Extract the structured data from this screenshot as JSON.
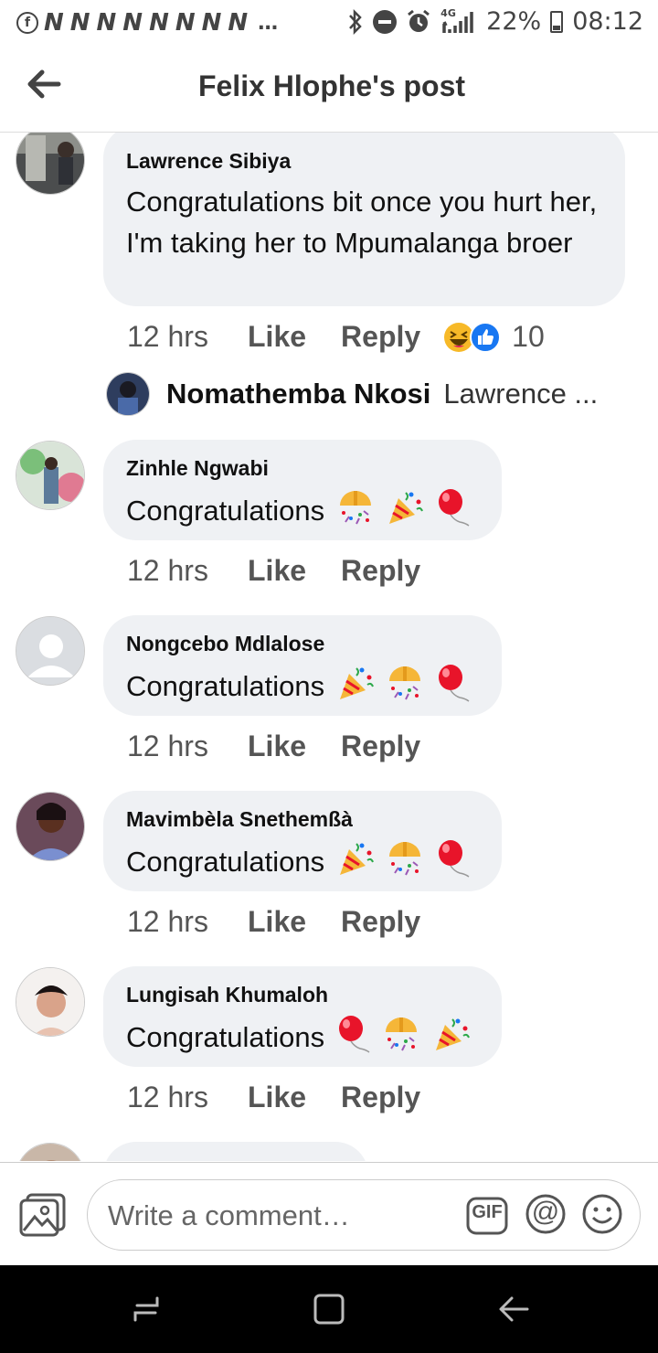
{
  "status_bar": {
    "signal_label": "4G",
    "battery": "22%",
    "time": "08:12",
    "notification_glyphs": [
      "N",
      "N",
      "N",
      "N",
      "N",
      "N",
      "N",
      "N"
    ],
    "more": "…"
  },
  "header": {
    "title": "Felix Hlophe's post",
    "back_icon": "arrow-left-icon"
  },
  "comments": [
    {
      "author": "Lawrence Sibiya",
      "text": "Congratulations bit once you hurt her, I'm taking her to  Mpumalanga broer",
      "time": "12 hrs",
      "like": "Like",
      "reply": "Reply",
      "reactions": [
        "haha",
        "like"
      ],
      "reaction_count": "10",
      "reply_preview": {
        "name": "Nomathemba Nkosi",
        "snippet": "Lawrence ..."
      }
    },
    {
      "author": "Zinhle Ngwabi",
      "text": "Congratulations",
      "emojis": [
        "confetti-ball",
        "party-popper",
        "balloon"
      ],
      "time": "12 hrs",
      "like": "Like",
      "reply": "Reply"
    },
    {
      "author": "Nongcebo Mdlalose",
      "text": "Congratulations",
      "emojis": [
        "party-popper",
        "confetti-ball",
        "balloon"
      ],
      "time": "12 hrs",
      "like": "Like",
      "reply": "Reply"
    },
    {
      "author": "Mavimbèla Snethemßà",
      "text": "Congratulations",
      "emojis": [
        "party-popper",
        "confetti-ball",
        "balloon"
      ],
      "time": "12 hrs",
      "like": "Like",
      "reply": "Reply"
    },
    {
      "author": "Lungisah Khumaloh",
      "text": "Congratulations",
      "emojis": [
        "balloon",
        "confetti-ball",
        "party-popper"
      ],
      "time": "12 hrs",
      "like": "Like",
      "reply": "Reply"
    }
  ],
  "composer": {
    "placeholder": "Write a comment…",
    "gif_label": "GIF",
    "mention_label": "@",
    "icons": [
      "photo-icon",
      "gif-icon",
      "mention-icon",
      "emoji-smile-icon"
    ]
  },
  "nav_bar": {
    "icons": [
      "recent-apps-icon",
      "home-icon",
      "back-icon"
    ]
  },
  "colors": {
    "bubble": "#eff1f4",
    "like_blue": "#1877f2",
    "haha_yellow": "#f7b928",
    "balloon_red": "#e8142a"
  }
}
